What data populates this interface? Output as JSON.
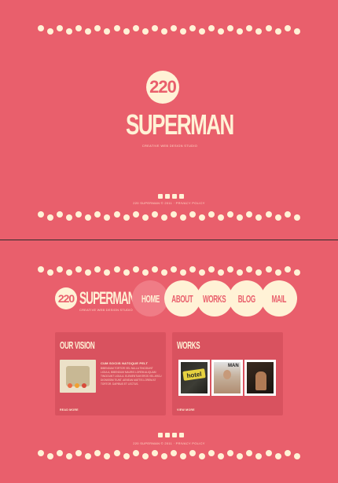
{
  "colors": {
    "background": "#e95f6c",
    "cream": "#fff2d6",
    "panel": "#d9525f",
    "active_nav": "#f07c86",
    "divider": "#2b2b2b"
  },
  "hero": {
    "badge": "220",
    "title": "SUPERMAN",
    "tagline": "CREATIVE WEB DESIGN STUDIO",
    "social_icons": [
      "delicious-icon",
      "twitter-icon",
      "skype-icon",
      "facebook-icon"
    ],
    "copyright": "220 SUPERMAN © 2011 · PRIVACY POLICY"
  },
  "header": {
    "logo_badge": "220",
    "logo_title": "SUPERMAN",
    "logo_tagline": "CREATIVE WEB DESIGN STUDIO"
  },
  "nav": {
    "items": [
      {
        "label": "HOME",
        "active": true
      },
      {
        "label": "ABOUT",
        "active": false
      },
      {
        "label": "WORKS",
        "active": false
      },
      {
        "label": "BLOG",
        "active": false
      },
      {
        "label": "MAIL",
        "active": false
      }
    ]
  },
  "vision": {
    "title": "OUR VISION",
    "heading": "CUM SOCIIS NATOQUE PELT",
    "body": "BIBENDUM TORTOR VEL NULLA TINCIDUNT LIGULA, BIBENDUM MAURIS LOREM ALIQUAM TINCIDUNT LIGULA. ELEMENTUM EROS VEL ARCU DIGNISSIM TIUNT. AENEAN MATTIS LOREM AT TORTOR. DAPIBUS ET LECTUS.",
    "read_more": "READ MORE"
  },
  "works": {
    "title": "WORKS",
    "thumbs": [
      {
        "caption": "hotel"
      },
      {
        "caption": "MAN"
      },
      {
        "caption": ""
      }
    ],
    "read_more": "VIEW MORE"
  },
  "footer": {
    "social_icons": [
      "delicious-icon",
      "twitter-icon",
      "skype-icon",
      "facebook-icon"
    ],
    "copyright": "220 SUPERMAN © 2011 · PRIVACY POLICY"
  }
}
